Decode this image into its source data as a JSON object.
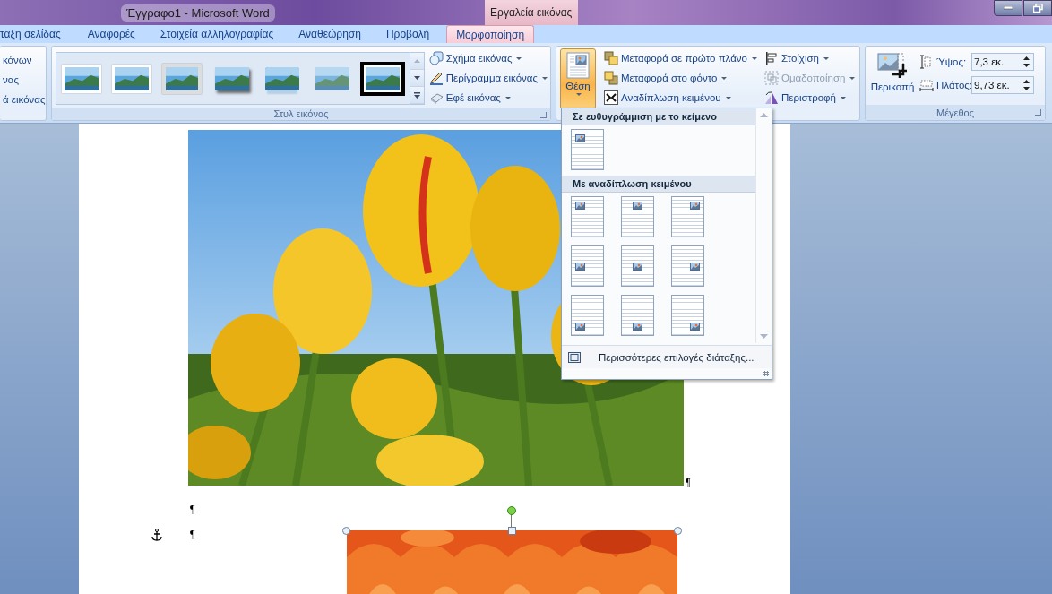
{
  "title_bar": {
    "title": "Έγγραφο1 - Microsoft Word",
    "contextual_tab": "Εργαλεία εικόνας"
  },
  "tabs": [
    {
      "label": "ταξη σελίδας",
      "selected": false
    },
    {
      "label": "Αναφορές",
      "selected": false
    },
    {
      "label": "Στοιχεία αλληλογραφίας",
      "selected": false
    },
    {
      "label": "Αναθεώρηση",
      "selected": false
    },
    {
      "label": "Προβολή",
      "selected": false
    },
    {
      "label": "Μορφοποίηση",
      "selected": true
    }
  ],
  "ribbon": {
    "partial_group": {
      "items": [
        "κόνων",
        "νας",
        "ά εικόνας"
      ]
    },
    "picture_styles": {
      "title": "Στυλ εικόνας",
      "styles": [
        {
          "kind": "frame"
        },
        {
          "kind": "frame"
        },
        {
          "kind": "matte"
        },
        {
          "kind": "shadow"
        },
        {
          "kind": "reflect"
        },
        {
          "kind": "soft"
        },
        {
          "kind": "black"
        }
      ],
      "commands": [
        {
          "label": "Σχήμα εικόνας",
          "kind": "shape"
        },
        {
          "label": "Περίγραμμα εικόνας",
          "kind": "border"
        },
        {
          "label": "Εφέ εικόνας",
          "kind": "effects"
        }
      ]
    },
    "arrange": {
      "position_button": {
        "label": "Θέση",
        "expanded": true
      },
      "commands": [
        {
          "label": "Μεταφορά σε πρώτο πλάνο",
          "kind": "front",
          "disabled": false
        },
        {
          "label": "Μεταφορά στο φόντο",
          "kind": "back",
          "disabled": false
        },
        {
          "label": "Αναδίπλωση κειμένου",
          "kind": "wrap",
          "disabled": false
        }
      ],
      "commands_2": [
        {
          "label": "Στοίχιση",
          "kind": "align",
          "disabled": false
        },
        {
          "label": "Ομαδοποίηση",
          "kind": "group",
          "disabled": true
        },
        {
          "label": "Περιστροφή",
          "kind": "rotate",
          "disabled": false
        }
      ]
    },
    "size": {
      "title": "Μέγεθος",
      "crop": "Περικοπή",
      "fields": [
        {
          "label": "Ύψος:",
          "value": "7,3 εκ.",
          "kind": "height"
        },
        {
          "label": "Πλάτος:",
          "value": "9,73 εκ.",
          "kind": "width"
        }
      ]
    }
  },
  "position_menu": {
    "sections": [
      {
        "heading": "Σε ευθυγράμμιση με το κείμενο",
        "options": [
          {
            "kind": "inline"
          }
        ]
      },
      {
        "heading": "Με αναδίπλωση κειμένου",
        "options": [
          {
            "kind": "topleft"
          },
          {
            "kind": "topcenter"
          },
          {
            "kind": "topright"
          },
          {
            "kind": "middleleft"
          },
          {
            "kind": "middlecenter"
          },
          {
            "kind": "middleright"
          },
          {
            "kind": "bottomleft"
          },
          {
            "kind": "bottomcenter"
          },
          {
            "kind": "bottomright"
          }
        ]
      }
    ],
    "more": "Περισσότερες επιλογές διάταξης..."
  },
  "document": {
    "picture_end_mark": "¶",
    "paragraphs": [
      {
        "mark": "¶",
        "anchored": false
      },
      {
        "mark": "¶",
        "anchored": true
      }
    ],
    "floating_picture": {
      "kind": "picture",
      "selected": true
    }
  }
}
